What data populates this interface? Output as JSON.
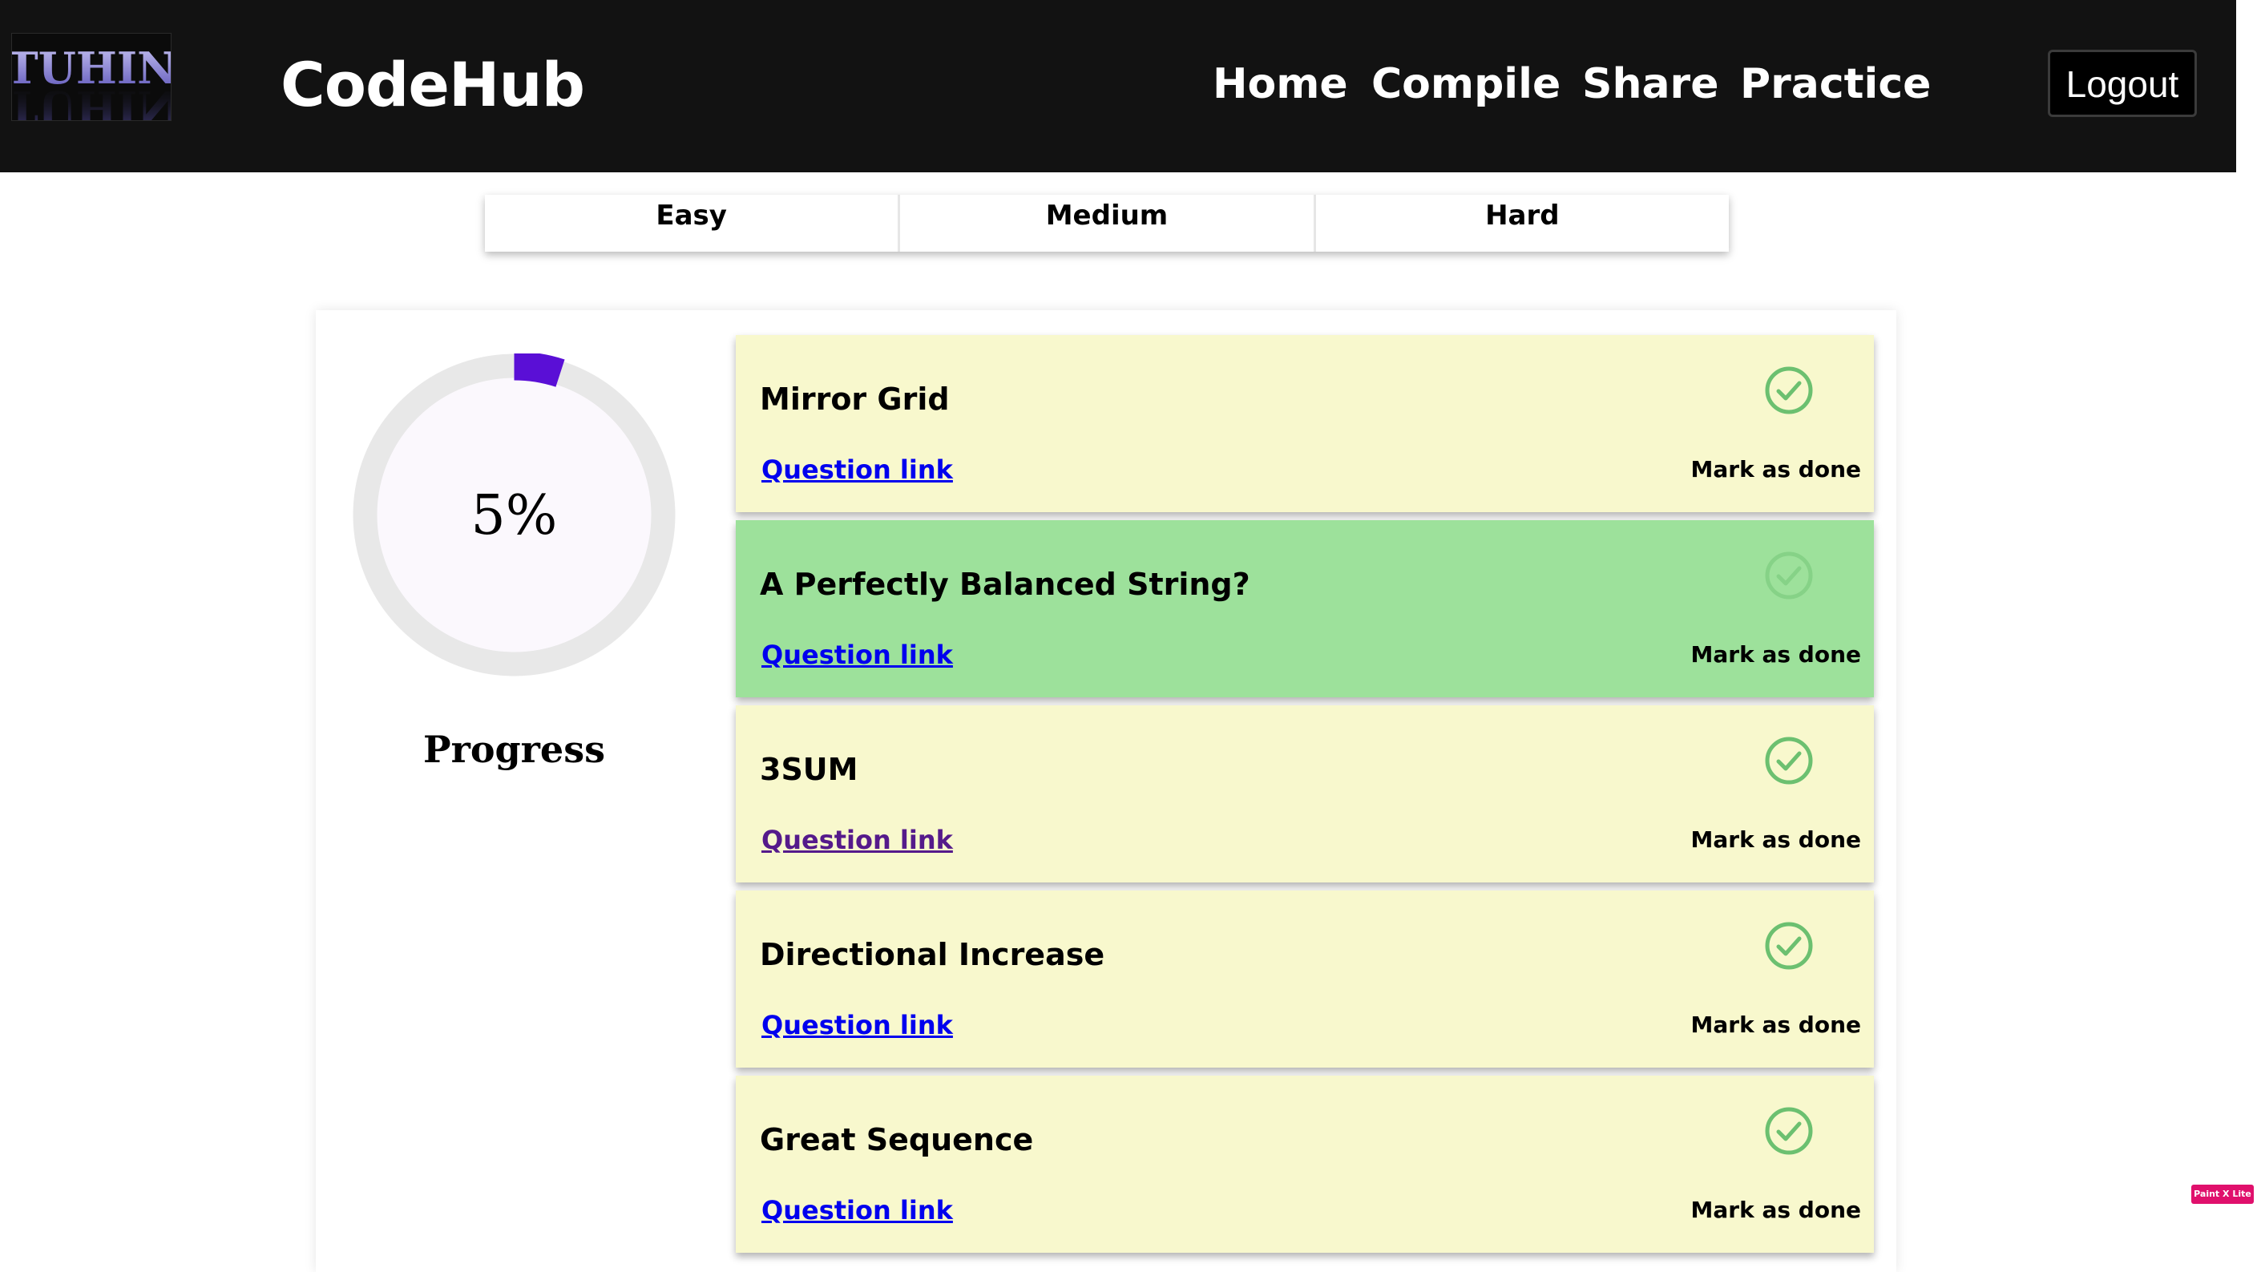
{
  "header": {
    "logo_text": "TUHIN",
    "brand": "CodeHub",
    "nav": [
      {
        "label": "Home"
      },
      {
        "label": "Compile"
      },
      {
        "label": "Share"
      },
      {
        "label": "Practice"
      }
    ],
    "logout_label": "Logout"
  },
  "tabs": [
    {
      "label": "Easy"
    },
    {
      "label": "Medium"
    },
    {
      "label": "Hard"
    }
  ],
  "progress": {
    "percent": 5,
    "percent_text": "5%",
    "label": "Progress",
    "color": "#5a0fd6",
    "track_color": "#e8e8e8",
    "fill_color": "#fbf8fd"
  },
  "questions": [
    {
      "title": "Mirror Grid",
      "link_text": "Question link",
      "mark_label": "Mark as done",
      "done": false,
      "link_visited": false
    },
    {
      "title": "A Perfectly Balanced String?",
      "link_text": "Question link",
      "mark_label": "Mark as done",
      "done": true,
      "link_visited": false
    },
    {
      "title": "3SUM",
      "link_text": "Question link",
      "mark_label": "Mark as done",
      "done": false,
      "link_visited": true
    },
    {
      "title": "Directional Increase",
      "link_text": "Question link",
      "mark_label": "Mark as done",
      "done": false,
      "link_visited": false
    },
    {
      "title": "Great Sequence",
      "link_text": "Question link",
      "mark_label": "Mark as done",
      "done": false,
      "link_visited": false
    }
  ],
  "colors": {
    "navbar_bg": "#121212",
    "card_pending": "#f8f8cd",
    "card_done": "#9de19b",
    "check_green": "#6cc070",
    "link": "#0000ee",
    "link_visited": "#551a8b"
  },
  "extension_badge": "Paint X Lite"
}
